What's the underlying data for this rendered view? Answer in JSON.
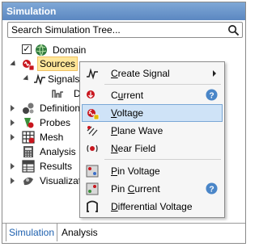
{
  "panel": {
    "title": "Simulation"
  },
  "search": {
    "placeholder": "Search Simulation Tree..."
  },
  "tree": {
    "domain": "Domain",
    "sources": "Sources",
    "signals": "Signals",
    "de": "De",
    "definitions": "Definitions",
    "probes": "Probes",
    "mesh": "Mesh",
    "analysis": "Analysis",
    "results": "Results",
    "visualization": "Visualization"
  },
  "menu": {
    "create_signal": {
      "label": "Create Signal",
      "accel": "C",
      "rest": "reate Signal"
    },
    "current": {
      "label": "Current",
      "accel": "u",
      "pre": "C",
      "rest": "rrent"
    },
    "voltage": {
      "label": "Voltage",
      "accel": "V",
      "rest": "oltage"
    },
    "plane_wave": {
      "label": "Plane Wave",
      "accel": "P",
      "rest": "lane Wave"
    },
    "near_field": {
      "label": "Near Field",
      "accel": "N",
      "rest": "ear Field"
    },
    "pin_voltage": {
      "label": "Pin Voltage",
      "accel": "P",
      "rest": "in Voltage"
    },
    "pin_current": {
      "label": "Pin Current",
      "accel": "C",
      "pre": "Pin ",
      "rest": "urrent"
    },
    "differential_voltage": {
      "label": "Differential Voltage",
      "accel": "D",
      "rest": "ifferential Voltage"
    }
  },
  "tabs": {
    "simulation": "Simulation",
    "analysis": "Analysis"
  },
  "colors": {
    "title_bar": "#6a96cc",
    "highlight": "#cfe3f7",
    "selected": "#ffe79a",
    "active_tab": "#1c5fae"
  }
}
